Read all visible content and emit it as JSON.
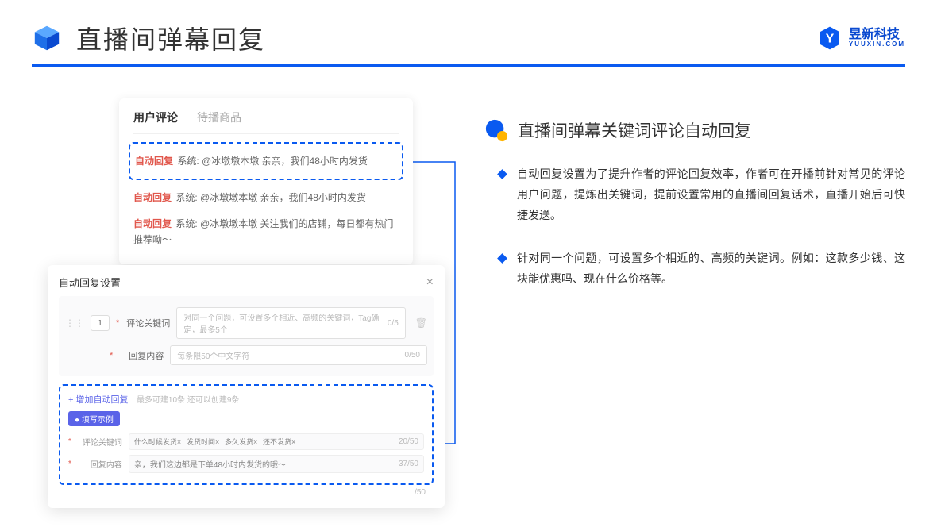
{
  "header": {
    "title": "直播间弹幕回复",
    "brand_cn": "昱新科技",
    "brand_en": "YUUXIN.COM"
  },
  "comments": {
    "tab1": "用户评论",
    "tab2": "待播商品",
    "row1_tag": "自动回复",
    "row1_text": " 系统: @冰墩墩本墩 亲亲，我们48小时内发货",
    "row2_tag": "自动回复",
    "row2_text": " 系统: @冰墩墩本墩 亲亲，我们48小时内发货",
    "row3_tag": "自动回复",
    "row3_text": " 系统: @冰墩墩本墩 关注我们的店铺，每日都有热门推荐呦～"
  },
  "settings": {
    "title": "自动回复设置",
    "seq": "1",
    "label_keyword": "评论关键词",
    "placeholder_keyword": "对同一个问题，可设置多个相近、高频的关键词，Tag确定，最多5个",
    "count_keyword": "0/5",
    "label_content": "回复内容",
    "placeholder_content": "每条限50个中文字符",
    "count_content": "0/50",
    "add_link": "+ 增加自动回复",
    "add_hint": "最多可建10条 还可以创建9条",
    "example_badge": "● 填写示例",
    "ex_label_kw": "评论关键词",
    "ex_tag1": "什么时候发货×",
    "ex_tag2": "发货时间×",
    "ex_tag3": "多久发货×",
    "ex_tag4": "还不发货×",
    "ex_count_kw": "20/50",
    "ex_label_ct": "回复内容",
    "ex_content": "亲，我们这边都是下单48小时内发货的哦～",
    "ex_count_ct": "37/50",
    "outer_count": "/50"
  },
  "right": {
    "section_title": "直播间弹幕关键词评论自动回复",
    "bullet1": "自动回复设置为了提升作者的评论回复效率，作者可在开播前针对常见的评论用户问题，提炼出关键词，提前设置常用的直播间回复话术，直播开始后可快捷发送。",
    "bullet2": "针对同一个问题，可设置多个相近的、高频的关键词。例如：这款多少钱、这块能优惠吗、现在什么价格等。"
  }
}
